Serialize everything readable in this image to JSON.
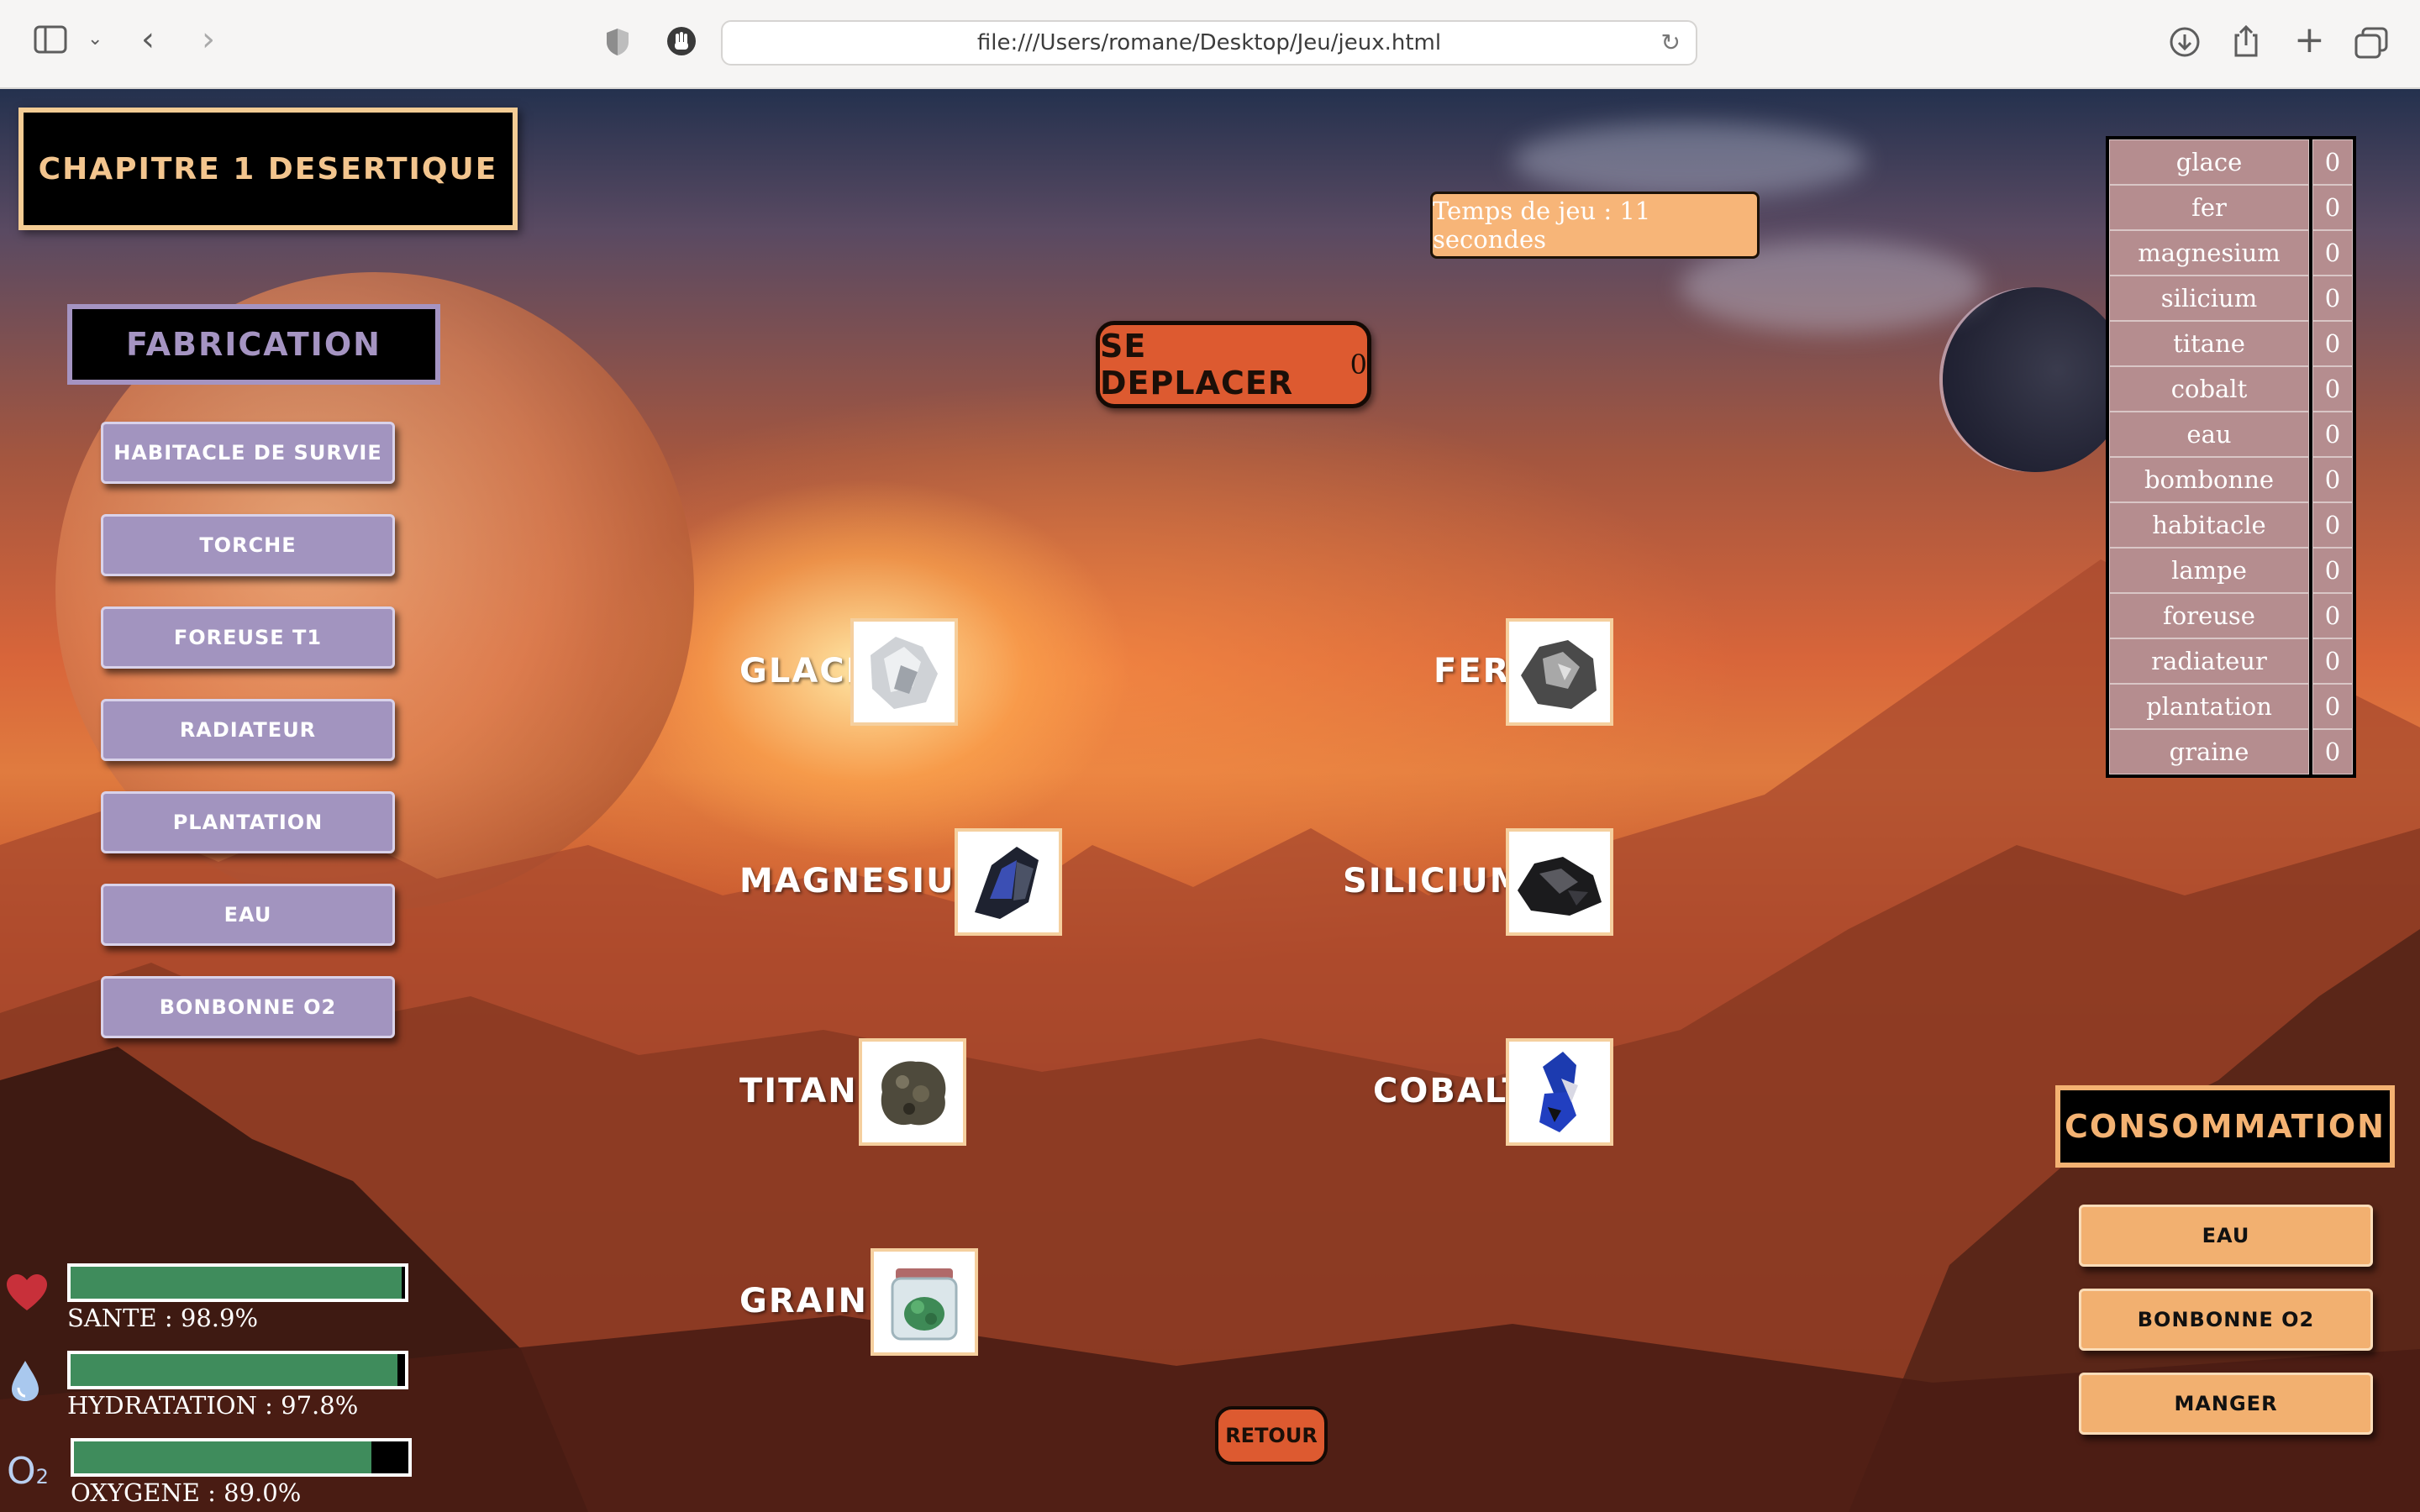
{
  "browser": {
    "url": "file:///Users/romane/Desktop/Jeu/jeux.html"
  },
  "chapter": {
    "title": "CHAPITRE 1 DESERTIQUE"
  },
  "timer": {
    "text": "Temps de jeu : 11 secondes"
  },
  "move": {
    "label": "SE DEPLACER",
    "count": "0"
  },
  "fabrication": {
    "title": "FABRICATION",
    "buttons": [
      "HABITACLE DE SURVIE",
      "TORCHE",
      "FOREUSE T1",
      "RADIATEUR",
      "PLANTATION",
      "EAU",
      "BONBONNE O2"
    ]
  },
  "resources": {
    "glace": "GLACE",
    "fer": "FER",
    "magnesium": "MAGNESIUM",
    "silicium": "SILICIUM",
    "titane": "TITANE",
    "cobalt": "COBALT",
    "graine": "GRAINE"
  },
  "inventory": [
    {
      "name": "glace",
      "qty": "0"
    },
    {
      "name": "fer",
      "qty": "0"
    },
    {
      "name": "magnesium",
      "qty": "0"
    },
    {
      "name": "silicium",
      "qty": "0"
    },
    {
      "name": "titane",
      "qty": "0"
    },
    {
      "name": "cobalt",
      "qty": "0"
    },
    {
      "name": "eau",
      "qty": "0"
    },
    {
      "name": "bombonne",
      "qty": "0"
    },
    {
      "name": "habitacle",
      "qty": "0"
    },
    {
      "name": "lampe",
      "qty": "0"
    },
    {
      "name": "foreuse",
      "qty": "0"
    },
    {
      "name": "radiateur",
      "qty": "0"
    },
    {
      "name": "plantation",
      "qty": "0"
    },
    {
      "name": "graine",
      "qty": "0"
    }
  ],
  "consommation": {
    "title": "CONSOMMATION",
    "buttons": [
      "EAU",
      "BONBONNE O2",
      "MANGER"
    ]
  },
  "stats": {
    "sante": {
      "label": "SANTE : 98.9%",
      "value": 98.9,
      "icon": "heart-icon"
    },
    "hydratation": {
      "label": "HYDRATATION : 97.8%",
      "value": 97.8,
      "icon": "water-drop-icon"
    },
    "oxygene": {
      "label": "OXYGENE : 89.0%",
      "value": 89.0,
      "icon": "oxygen-icon",
      "icon_text": "O2"
    }
  },
  "retour": {
    "label": "RETOUR"
  },
  "colors": {
    "bar_fill": "#3f8c5c",
    "fabrication_accent": "#a294bf",
    "consommation_accent": "#f2b070",
    "action_button": "#dd5a30"
  }
}
